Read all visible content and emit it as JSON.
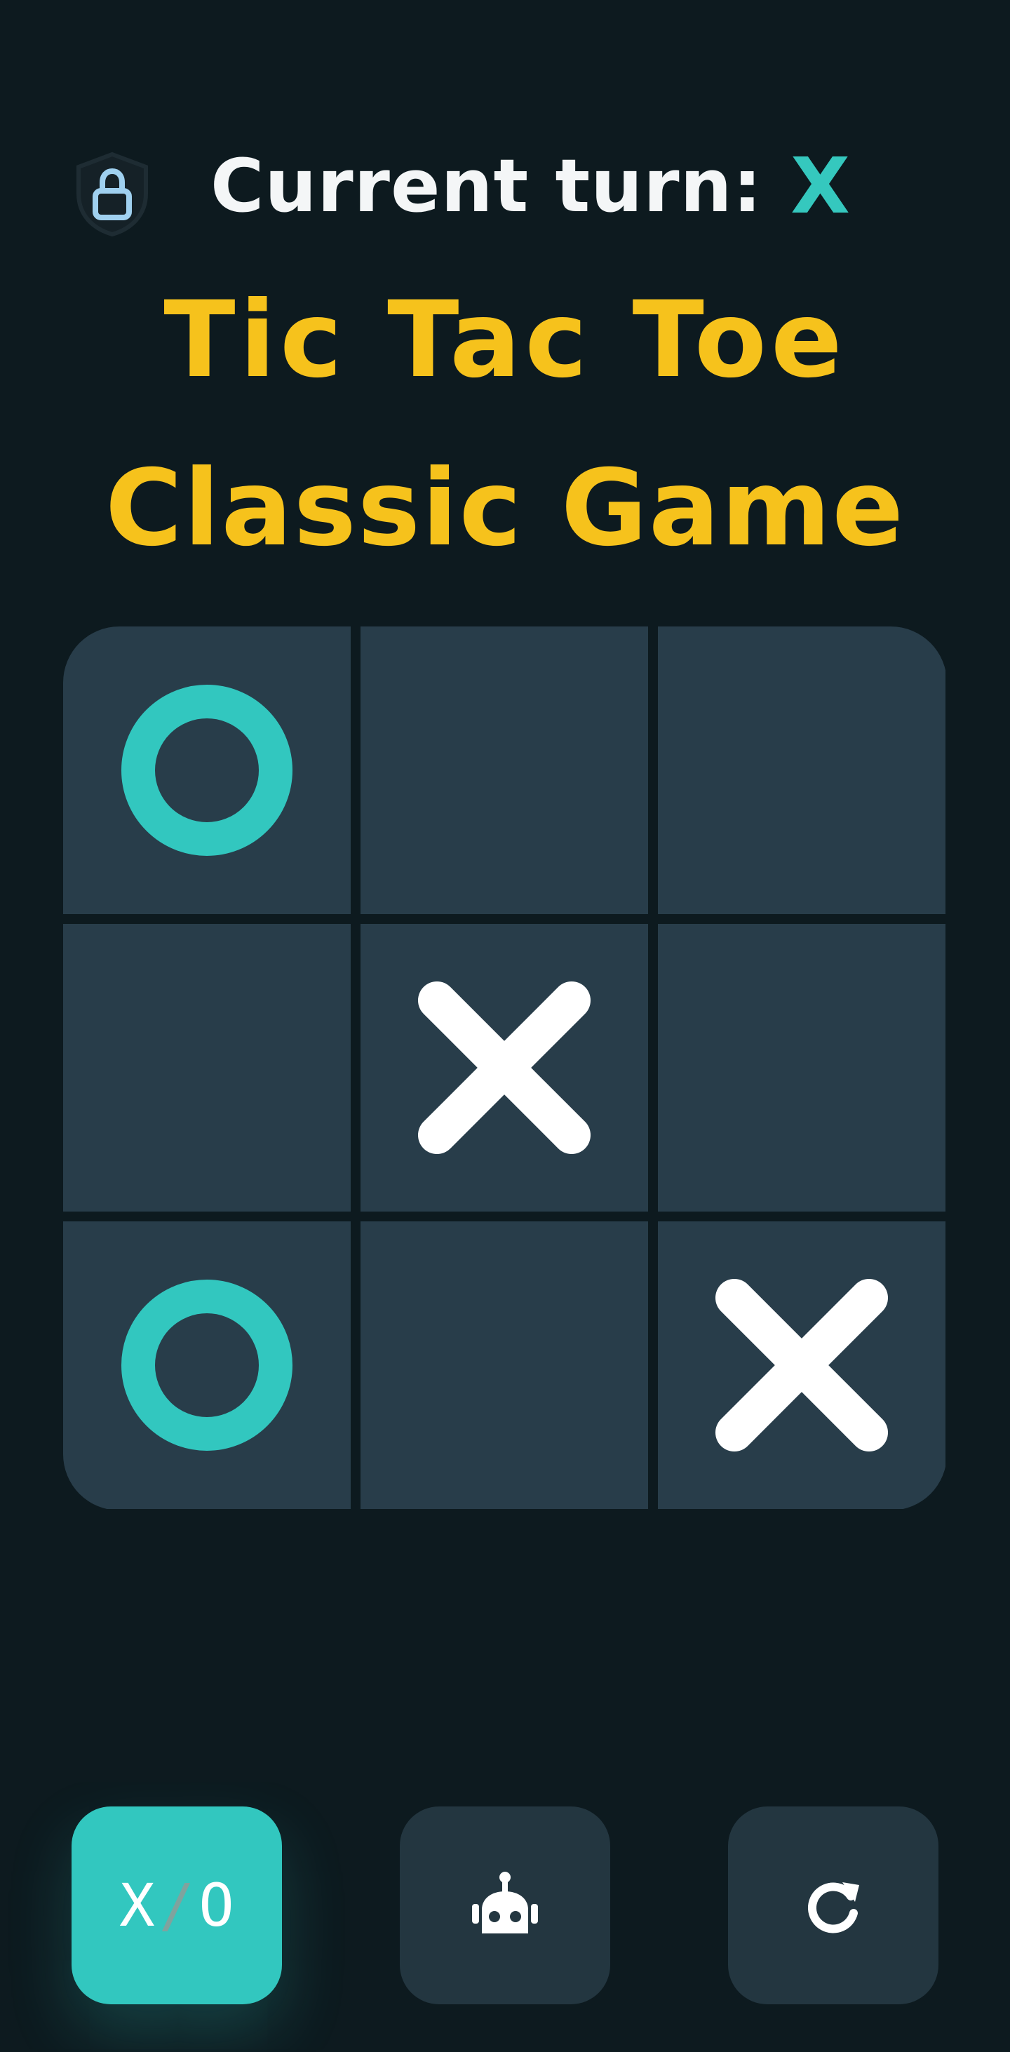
{
  "status": {
    "turn_label": "Current turn:",
    "turn_value": "X"
  },
  "title": {
    "line1": "Tic Tac Toe",
    "line2": "Classic Game"
  },
  "board": {
    "cells": [
      "O",
      "",
      "",
      "",
      "X",
      "",
      "O",
      "",
      "X"
    ]
  },
  "controls": {
    "mode_x": "X",
    "mode_sep": "/",
    "mode_o": "O",
    "bot_icon": "robot-icon",
    "reset_icon": "restart-icon"
  },
  "icons": {
    "status_icon": "shield-lock-icon"
  },
  "colors": {
    "background": "#0d1a1f",
    "cell": "#283d4a",
    "accent": "#32c7bf",
    "title": "#f6c21c",
    "mark_x": "#ffffff",
    "mark_o": "#32c7bf"
  }
}
